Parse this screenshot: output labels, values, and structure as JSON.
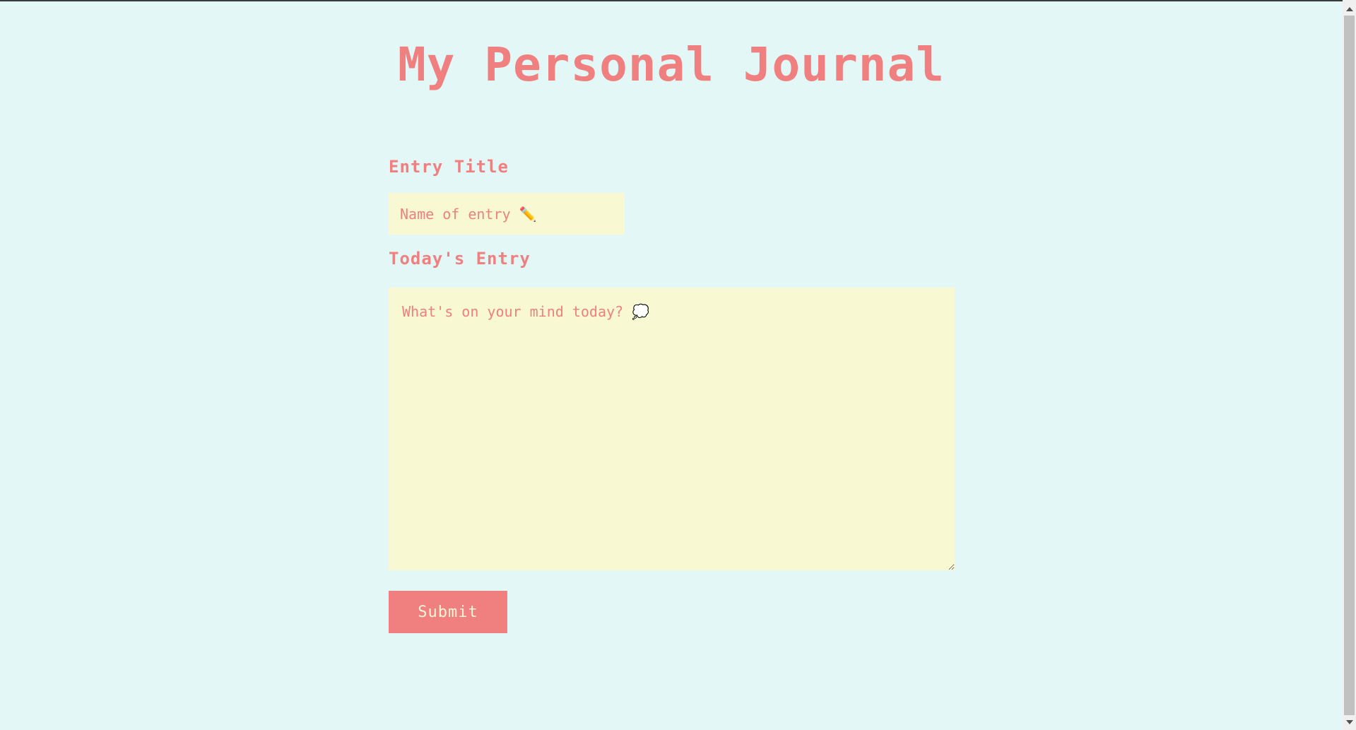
{
  "page": {
    "title": "My Personal Journal"
  },
  "form": {
    "entry_title_label": "Entry Title",
    "entry_title_placeholder": "Name of entry ✏️",
    "entry_title_value": "",
    "today_entry_label": "Today's Entry",
    "today_entry_placeholder": "What's on your mind today? 💭",
    "today_entry_value": "",
    "submit_label": "Submit"
  },
  "colors": {
    "background": "#e3f7f7",
    "accent": "#f08080",
    "field_background": "#f8f9d2",
    "button_text": "#fdf6d4"
  },
  "icons": {
    "title_field_icon": "pencil-icon",
    "entry_field_icon": "thought-bubble-icon"
  }
}
